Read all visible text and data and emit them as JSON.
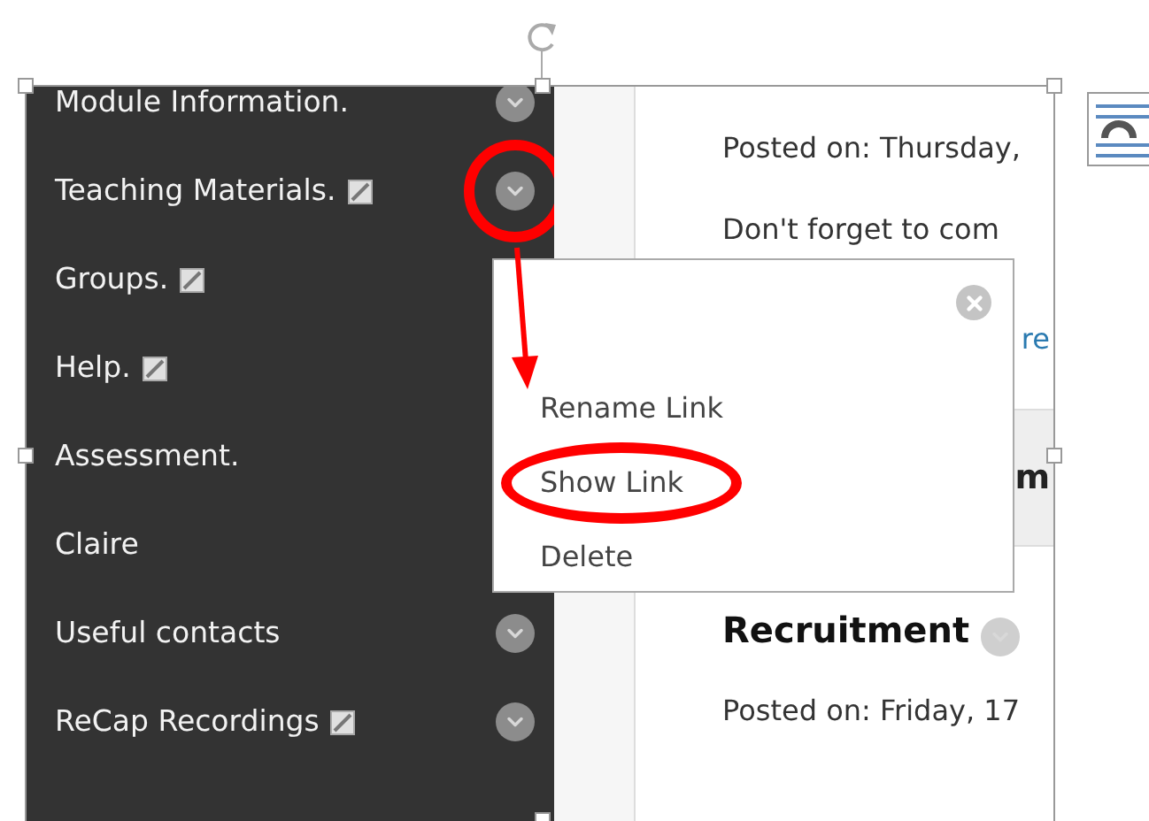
{
  "sidebar": {
    "items": [
      {
        "label": "Module Information.",
        "edit_icon": false,
        "chevron": true,
        "annotated": false
      },
      {
        "label": "Teaching Materials.",
        "edit_icon": true,
        "chevron": true,
        "annotated": true
      },
      {
        "label": "Groups.",
        "edit_icon": true,
        "chevron": false
      },
      {
        "label": "Help.",
        "edit_icon": true,
        "chevron": false
      },
      {
        "label": "Assessment.",
        "edit_icon": false,
        "chevron": false
      },
      {
        "label": "Claire",
        "edit_icon": false,
        "chevron": false
      },
      {
        "label": "Useful contacts",
        "edit_icon": false,
        "chevron": true,
        "annotated": false
      },
      {
        "label": "ReCap Recordings",
        "edit_icon": true,
        "chevron": true,
        "annotated": false
      }
    ]
  },
  "content": {
    "blocks": [
      {
        "kind": "meta",
        "text": "Posted on: Thursday,"
      },
      {
        "kind": "text",
        "text": "Don't forget to com"
      },
      {
        "kind": "link",
        "text": "re"
      },
      {
        "kind": "band",
        "text": "m"
      },
      {
        "kind": "heading",
        "text": "Recruitment"
      },
      {
        "kind": "meta",
        "text": "Posted on: Friday, 17"
      }
    ]
  },
  "popup": {
    "items": [
      {
        "label": "Rename Link",
        "annotated": false
      },
      {
        "label": "Show Link",
        "annotated": true
      },
      {
        "label": "Delete",
        "annotated": false
      }
    ]
  }
}
